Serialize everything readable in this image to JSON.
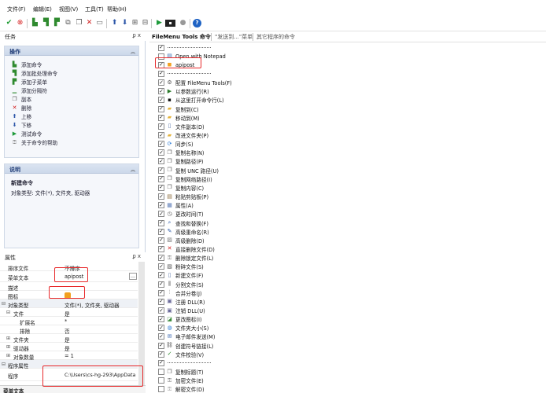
{
  "menu": [
    "文件(F)",
    "编辑(E)",
    "视图(V)",
    "工具(T)",
    "帮助(H)"
  ],
  "toolbar_icons": [
    "check-green",
    "cancel-red",
    "add-command",
    "add-batch",
    "add-submenu",
    "copy",
    "delete",
    "export",
    "move-up",
    "move-down",
    "expand",
    "collapse",
    "run",
    "console",
    "globe",
    "help"
  ],
  "left_pane": {
    "title": "任务",
    "pin": "ᵱ x",
    "actions": {
      "header": "操作",
      "items": [
        {
          "label": "添加命令",
          "icon": "add-command-icon"
        },
        {
          "label": "添加批处理命令",
          "icon": "add-batch-icon"
        },
        {
          "label": "添加子菜单",
          "icon": "add-submenu-icon"
        },
        {
          "label": "添加分隔符",
          "icon": "add-separator-icon"
        },
        {
          "label": "副本",
          "icon": "copy-icon"
        },
        {
          "label": "删除",
          "icon": "delete-icon"
        },
        {
          "label": "上移",
          "icon": "arrow-up-icon"
        },
        {
          "label": "下移",
          "icon": "arrow-down-icon"
        },
        {
          "label": "测试命令",
          "icon": "play-icon"
        },
        {
          "label": "关于命令的帮助",
          "icon": "help-icon"
        }
      ]
    },
    "description": {
      "header": "说明",
      "title": "新建命令",
      "text": "对象类型: 文件(*), 文件夹, 驱动器"
    }
  },
  "properties": {
    "title": "属性",
    "pin": "ᵱ x",
    "rows": [
      {
        "name": "排序文件",
        "value": "不排序"
      },
      {
        "name": "菜单文本",
        "value": "apipost"
      },
      {
        "name": "描述",
        "value": ""
      },
      {
        "name": "图标",
        "value": ""
      },
      {
        "name": "对象类型",
        "value": "文件(*), 文件夹, 驱动器"
      },
      {
        "name": "文件",
        "value": "是"
      },
      {
        "name": "扩展名",
        "value": "*"
      },
      {
        "name": "排除",
        "value": "否"
      },
      {
        "name": "文件夹",
        "value": "是"
      },
      {
        "name": "驱动器",
        "value": "是"
      },
      {
        "name": "对象数量",
        "value": "= 1"
      },
      {
        "name": "程序属性",
        "value": ""
      },
      {
        "name": "程序",
        "value": "C:\\Users\\cs-hg-293\\AppData"
      }
    ],
    "bottom_label": "菜单文本"
  },
  "right_pane": {
    "tabs": [
      "FileMenu Tools 命令",
      "\"发送到...\"菜单",
      "其它程序的命令"
    ],
    "items": [
      {
        "label": "",
        "sep": true,
        "checked": true
      },
      {
        "label": "Open with Notepad",
        "checked": false,
        "icon": "notepad"
      },
      {
        "label": "apipost",
        "checked": true,
        "icon": "app"
      },
      {
        "label": "",
        "sep": true,
        "checked": true
      },
      {
        "label": "配置 FileMenu Tools(F)",
        "checked": true,
        "icon": "config"
      },
      {
        "label": "以参数运行(R)",
        "checked": true,
        "icon": "run"
      },
      {
        "label": "从这里打开命令行(L)",
        "checked": true,
        "icon": "console"
      },
      {
        "label": "复制到(C)",
        "checked": true,
        "icon": "folder"
      },
      {
        "label": "移动到(M)",
        "checked": true,
        "icon": "folder"
      },
      {
        "label": "文件副本(D)",
        "checked": true,
        "icon": "file"
      },
      {
        "label": "改进文件夹(P)",
        "checked": true,
        "icon": "folder"
      },
      {
        "label": "同步(S)",
        "checked": true,
        "icon": "sync"
      },
      {
        "label": "复制名称(N)",
        "checked": true,
        "icon": "copy"
      },
      {
        "label": "复制路径(P)",
        "checked": true,
        "icon": "copy"
      },
      {
        "label": "复制 UNC 路径(U)",
        "checked": true,
        "icon": "copy"
      },
      {
        "label": "复制网络路径(I)",
        "checked": true,
        "icon": "copy"
      },
      {
        "label": "复制内容(C)",
        "checked": true,
        "icon": "copy"
      },
      {
        "label": "粘贴剪贴板(P)",
        "checked": true,
        "icon": "paste"
      },
      {
        "label": "属性(A)",
        "checked": true,
        "icon": "props"
      },
      {
        "label": "更改时间(T)",
        "checked": true,
        "icon": "clock"
      },
      {
        "label": "查找和替换(F)",
        "checked": true,
        "icon": "find"
      },
      {
        "label": "高级重命名(R)",
        "checked": true,
        "icon": "rename"
      },
      {
        "label": "高级删除(D)",
        "checked": true,
        "icon": "delete"
      },
      {
        "label": "直接删除文件(D)",
        "checked": true,
        "icon": "x"
      },
      {
        "label": "删除锁定文件(L)",
        "checked": true,
        "icon": "lock"
      },
      {
        "label": "粉碎文件(S)",
        "checked": true,
        "icon": "shred"
      },
      {
        "label": "新建文件(F)",
        "checked": true,
        "icon": "file"
      },
      {
        "label": "分割文件(S)",
        "checked": true,
        "icon": "split"
      },
      {
        "label": "合并分卷(J)",
        "checked": true,
        "icon": "join"
      },
      {
        "label": "注册 DLL(R)",
        "checked": true,
        "icon": "dll"
      },
      {
        "label": "注销 DLL(U)",
        "checked": true,
        "icon": "dll"
      },
      {
        "label": "更改图标(I)",
        "checked": true,
        "icon": "icon"
      },
      {
        "label": "文件夹大小(S)",
        "checked": true,
        "icon": "globe"
      },
      {
        "label": "电子邮件发送(M)",
        "checked": true,
        "icon": "mail"
      },
      {
        "label": "创建符号链接(L)",
        "checked": true,
        "icon": "link"
      },
      {
        "label": "文件校验(V)",
        "checked": true,
        "icon": "check"
      },
      {
        "label": "",
        "sep": true,
        "checked": true
      },
      {
        "label": "复制标题(T)",
        "checked": false,
        "icon": "copy"
      },
      {
        "label": "加密文件(E)",
        "checked": false,
        "icon": "lock"
      },
      {
        "label": "解密文件(D)",
        "checked": false,
        "icon": "unlock"
      }
    ]
  }
}
